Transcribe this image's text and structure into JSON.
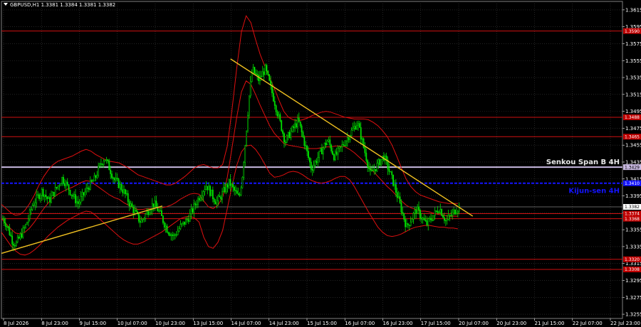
{
  "header": {
    "symbol_line": "GBPUSD,H1  1.3381 1.3384 1.3381 1.3382"
  },
  "colors": {
    "background": "#000000",
    "grid": "#3a3a3a",
    "candle_up": "#00e000",
    "candle_down": "#00e000",
    "bands": "#e01010",
    "trendline": "#f0c020",
    "resistance": "#d01010",
    "senkou": "#c8b8e0",
    "kijun": "#1414ff",
    "price_tag": "#c00000"
  },
  "chart_data": {
    "type": "candlestick",
    "ylim": [
      1.325,
      1.3625
    ],
    "y_ticks": [
      "1.3615",
      "1.3595",
      "1.3575",
      "1.3555",
      "1.3535",
      "1.3515",
      "1.3495",
      "1.3475",
      "1.3455",
      "1.3435",
      "1.3415",
      "1.3395",
      "1.3375",
      "1.3355",
      "1.3335",
      "1.3315",
      "1.3295",
      "1.3275",
      "1.3255"
    ],
    "x_tick_labels": [
      "8 Jul 2026",
      "8 Jul 23:00",
      "9 Jul 15:00",
      "10 Jul 07:00",
      "10 Jul 23:00",
      "13 Jul 15:00",
      "14 Jul 07:00",
      "14 Jul 23:00",
      "15 Jul 15:00",
      "16 Jul 07:00",
      "16 Jul 23:00",
      "17 Jul 15:00",
      "20 Jul 07:00",
      "20 Jul 23:00",
      "21 Jul 15:00",
      "22 Jul 07:00",
      "22 Jul 23:00"
    ],
    "bar_count": 340,
    "closes": [
      1.3368,
      1.3362,
      1.3352,
      1.3341,
      1.3338,
      1.3345,
      1.3352,
      1.336,
      1.3371,
      1.3384,
      1.339,
      1.3396,
      1.3401,
      1.3395,
      1.3389,
      1.3395,
      1.3402,
      1.3408,
      1.3416,
      1.3411,
      1.3404,
      1.3397,
      1.3391,
      1.3386,
      1.3393,
      1.3399,
      1.3406,
      1.341,
      1.3415,
      1.3425,
      1.3434,
      1.344,
      1.3432,
      1.3423,
      1.3414,
      1.341,
      1.3405,
      1.3399,
      1.3391,
      1.3383,
      1.3377,
      1.337,
      1.3364,
      1.337,
      1.3376,
      1.3382,
      1.3386,
      1.338,
      1.3373,
      1.3364,
      1.3356,
      1.3351,
      1.3347,
      1.3352,
      1.3358,
      1.3362,
      1.3366,
      1.3372,
      1.338,
      1.3388,
      1.3395,
      1.3402,
      1.3408,
      1.3401,
      1.3394,
      1.3388,
      1.3392,
      1.3399,
      1.3405,
      1.3411,
      1.3404,
      1.3398,
      1.3392,
      1.342,
      1.3465,
      1.3512,
      1.3545,
      1.3538,
      1.3532,
      1.3539,
      1.3545,
      1.3531,
      1.3517,
      1.3503,
      1.3488,
      1.3474,
      1.3459,
      1.3466,
      1.3472,
      1.3478,
      1.3484,
      1.347,
      1.3456,
      1.3441,
      1.3427,
      1.3434,
      1.3441,
      1.3448,
      1.3455,
      1.3461,
      1.3451,
      1.3441,
      1.3446,
      1.3452,
      1.3458,
      1.3464,
      1.347,
      1.3476,
      1.3482,
      1.3467,
      1.3451,
      1.3436,
      1.342,
      1.3426,
      1.3431,
      1.3437,
      1.3442,
      1.3432,
      1.3421,
      1.341,
      1.3397,
      1.3384,
      1.3371,
      1.3358,
      1.3365,
      1.3372,
      1.3379,
      1.3373,
      1.3367,
      1.3361,
      1.3366,
      1.3371,
      1.3376,
      1.3381,
      1.3373,
      1.3365,
      1.337,
      1.3374,
      1.3379,
      1.3382
    ],
    "upper_band": [
      1.3385,
      1.338,
      1.3375,
      1.3372,
      1.3373,
      1.3378,
      1.3386,
      1.3396,
      1.3408,
      1.3418,
      1.3426,
      1.3432,
      1.3436,
      1.3438,
      1.344,
      1.3442,
      1.3445,
      1.3448,
      1.345,
      1.3448,
      1.3444,
      1.3441,
      1.3438,
      1.3436,
      1.3435,
      1.3434,
      1.3431,
      1.3428,
      1.3424,
      1.342,
      1.3418,
      1.3416,
      1.3414,
      1.3412,
      1.341,
      1.3408,
      1.3408,
      1.341,
      1.3414,
      1.3418,
      1.3423,
      1.3428,
      1.3431,
      1.3432,
      1.343,
      1.3428,
      1.3428,
      1.3432,
      1.3454,
      1.3497,
      1.3546,
      1.3589,
      1.3608,
      1.36,
      1.358,
      1.3562,
      1.3548,
      1.3535,
      1.3522,
      1.3508,
      1.3495,
      1.3488,
      1.3485,
      1.3484,
      1.3485,
      1.3487,
      1.349,
      1.3492,
      1.3494,
      1.3495,
      1.3494,
      1.3492,
      1.349,
      1.3488,
      1.3487,
      1.3486,
      1.3486,
      1.3486,
      1.3485,
      1.3482,
      1.3478,
      1.3472,
      1.3465,
      1.3455,
      1.3442,
      1.3428,
      1.3415,
      1.3406,
      1.34,
      1.3396,
      1.3394,
      1.3392,
      1.339,
      1.3388,
      1.3387,
      1.3386,
      1.3386,
      1.3386
    ],
    "lower_band": [
      1.3352,
      1.3344,
      1.3336,
      1.333,
      1.3326,
      1.3325,
      1.3327,
      1.3331,
      1.3336,
      1.3342,
      1.3348,
      1.3353,
      1.3358,
      1.3362,
      1.3366,
      1.3369,
      1.3372,
      1.3375,
      1.3377,
      1.3376,
      1.3372,
      1.3367,
      1.3362,
      1.3357,
      1.3352,
      1.3347,
      1.3343,
      1.334,
      1.3338,
      1.3338,
      1.334,
      1.3343,
      1.3346,
      1.3349,
      1.3352,
      1.3356,
      1.336,
      1.3364,
      1.3368,
      1.337,
      1.3371,
      1.3369,
      1.3364,
      1.3346,
      1.3335,
      1.3333,
      1.334,
      1.3354,
      1.338,
      1.3407,
      1.3431,
      1.3447,
      1.3454,
      1.3455,
      1.345,
      1.3442,
      1.3432,
      1.3422,
      1.3417,
      1.3418,
      1.342,
      1.3423,
      1.3424,
      1.3423,
      1.342,
      1.3416,
      1.3413,
      1.3411,
      1.341,
      1.3411,
      1.3413,
      1.3416,
      1.3418,
      1.3418,
      1.3414,
      1.3406,
      1.3396,
      1.3386,
      1.3376,
      1.3367,
      1.3358,
      1.3352,
      1.3348,
      1.3347,
      1.3348,
      1.335,
      1.3353,
      1.3356,
      1.3358,
      1.3359,
      1.336,
      1.336,
      1.3359,
      1.3358,
      1.3358,
      1.3357,
      1.3357,
      1.3356
    ],
    "middle_band": [
      1.3368,
      1.3362,
      1.3356,
      1.3351,
      1.335,
      1.3352,
      1.3357,
      1.3364,
      1.3372,
      1.338,
      1.3387,
      1.3393,
      1.3397,
      1.34,
      1.3403,
      1.3405,
      1.3408,
      1.3411,
      1.3413,
      1.3412,
      1.3408,
      1.3404,
      1.34,
      1.3396,
      1.3393,
      1.3391,
      1.3387,
      1.3384,
      1.3381,
      1.3379,
      1.3379,
      1.338,
      1.338,
      1.3381,
      1.3381,
      1.3382,
      1.3384,
      1.3387,
      1.3391,
      1.3394,
      1.3397,
      1.3398,
      1.3397,
      1.3389,
      1.3382,
      1.338,
      1.3384,
      1.3393,
      1.3417,
      1.3452,
      1.3488,
      1.3518,
      1.3531,
      1.3527,
      1.3515,
      1.3502,
      1.349,
      1.3478,
      1.3469,
      1.3463,
      1.3457,
      1.3455,
      1.3454,
      1.3453,
      1.3452,
      1.3451,
      1.3451,
      1.3451,
      1.3452,
      1.3453,
      1.3453,
      1.3454,
      1.3454,
      1.3453,
      1.345,
      1.3446,
      1.3441,
      1.3436,
      1.343,
      1.3424,
      1.3418,
      1.3412,
      1.3406,
      1.3401,
      1.3395,
      1.3389,
      1.3384,
      1.3381,
      1.3379,
      1.3377,
      1.3377,
      1.3376,
      1.3374,
      1.3373,
      1.3372,
      1.3371,
      1.3371,
      1.3371
    ],
    "trendlines": [
      {
        "from": [
          0,
          1.3327
        ],
        "to": [
          0.2589,
          1.3383
        ]
      },
      {
        "from": [
          0.3689,
          1.3557
        ],
        "to": [
          0.7589,
          1.3371
        ]
      }
    ],
    "horizontal_levels": [
      {
        "value": 1.359,
        "kind": "resistance",
        "tag": "1.3590"
      },
      {
        "value": 1.3488,
        "kind": "resistance",
        "tag": "1.3488"
      },
      {
        "value": 1.3465,
        "kind": "resistance",
        "tag": "1.3465"
      },
      {
        "value": 1.3429,
        "kind": "senkou",
        "tag": "1.3429",
        "label": "Senkou Span B 4H"
      },
      {
        "value": 1.341,
        "kind": "kijun",
        "tag": "1.3410",
        "label": "Kijun-sen 4H"
      },
      {
        "value": 1.3382,
        "kind": "current",
        "tag": "1.3382"
      },
      {
        "value": 1.3374,
        "kind": "resistance",
        "tag": "1.3374"
      },
      {
        "value": 1.3368,
        "kind": "resistance",
        "tag": "1.3368"
      },
      {
        "value": 1.332,
        "kind": "resistance",
        "tag": "1.3320"
      },
      {
        "value": 1.3308,
        "kind": "resistance",
        "tag": "1.3308"
      }
    ]
  }
}
